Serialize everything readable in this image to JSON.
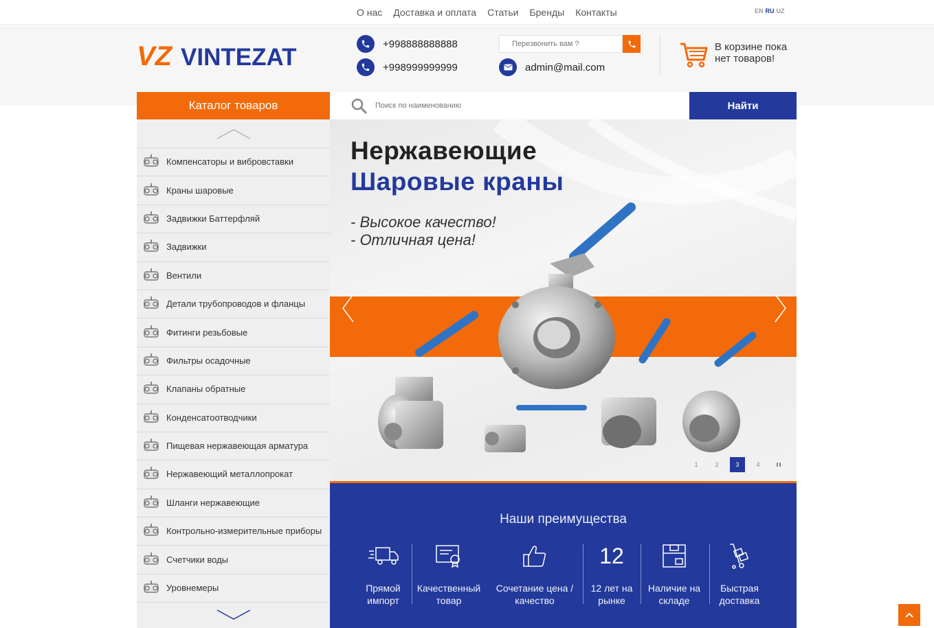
{
  "top_nav": {
    "links": [
      "О нас",
      "Доставка и оплата",
      "Статьи",
      "Бренды",
      "Контакты"
    ],
    "languages": [
      "EN",
      "RU",
      "UZ"
    ],
    "active_language": "RU"
  },
  "header": {
    "logo_mark": "VZ",
    "logo_text": "VINTEZAT",
    "phones": [
      "+998888888888",
      "+998999999999"
    ],
    "email": "admin@mail.com",
    "callback_placeholder": "Перезвонить вам ?",
    "cart_text_line1": "В корзине пока",
    "cart_text_line2": "нет товаров!"
  },
  "catalog": {
    "title": "Каталог товаров",
    "items": [
      "Компенсаторы и вибровставки",
      "Краны шаровые",
      "Задвижки Баттерфляй",
      "Задвижки",
      "Вентили",
      "Детали трубопроводов и фланцы",
      "Фитинги резьбовые",
      "Фильтры осадочные",
      "Клапаны обратные",
      "Конденсатоотводчики",
      "Пищевая нержавеющая арматура",
      "Нержавеющий металлопрокат",
      "Шланги нержавеющие",
      "Контрольно-измерительные приборы",
      "Счетчики воды",
      "Уровнемеры"
    ]
  },
  "search": {
    "placeholder": "Поиск по наименованию",
    "button_label": "Найти"
  },
  "slider": {
    "title_line1": "Нержавеющие",
    "title_line2": "Шаровые краны",
    "tagline1": "- Высокое качество!",
    "tagline2": "- Отличная цена!",
    "pages": [
      "1",
      "2",
      "3",
      "4"
    ],
    "active_page": "3"
  },
  "advantages": {
    "title": "Наши преимущества",
    "items": [
      {
        "line1": "Прямой",
        "line2": "импорт",
        "icon": "truck-icon"
      },
      {
        "line1": "Качественный",
        "line2": "товар",
        "icon": "certificate-icon"
      },
      {
        "line1": "Сочетание цена /",
        "line2": "качество",
        "icon": "thumbs-up-icon"
      },
      {
        "big": "12",
        "line1": "12 лет на",
        "line2": "рынке",
        "icon": ""
      },
      {
        "line1": "Наличие на",
        "line2": "складе",
        "icon": "box-icon"
      },
      {
        "line1": "Быстрая",
        "line2": "доставка",
        "icon": "hand-truck-icon"
      }
    ]
  },
  "colors": {
    "accent_orange": "#f26a0a",
    "brand_blue": "#23399b"
  }
}
